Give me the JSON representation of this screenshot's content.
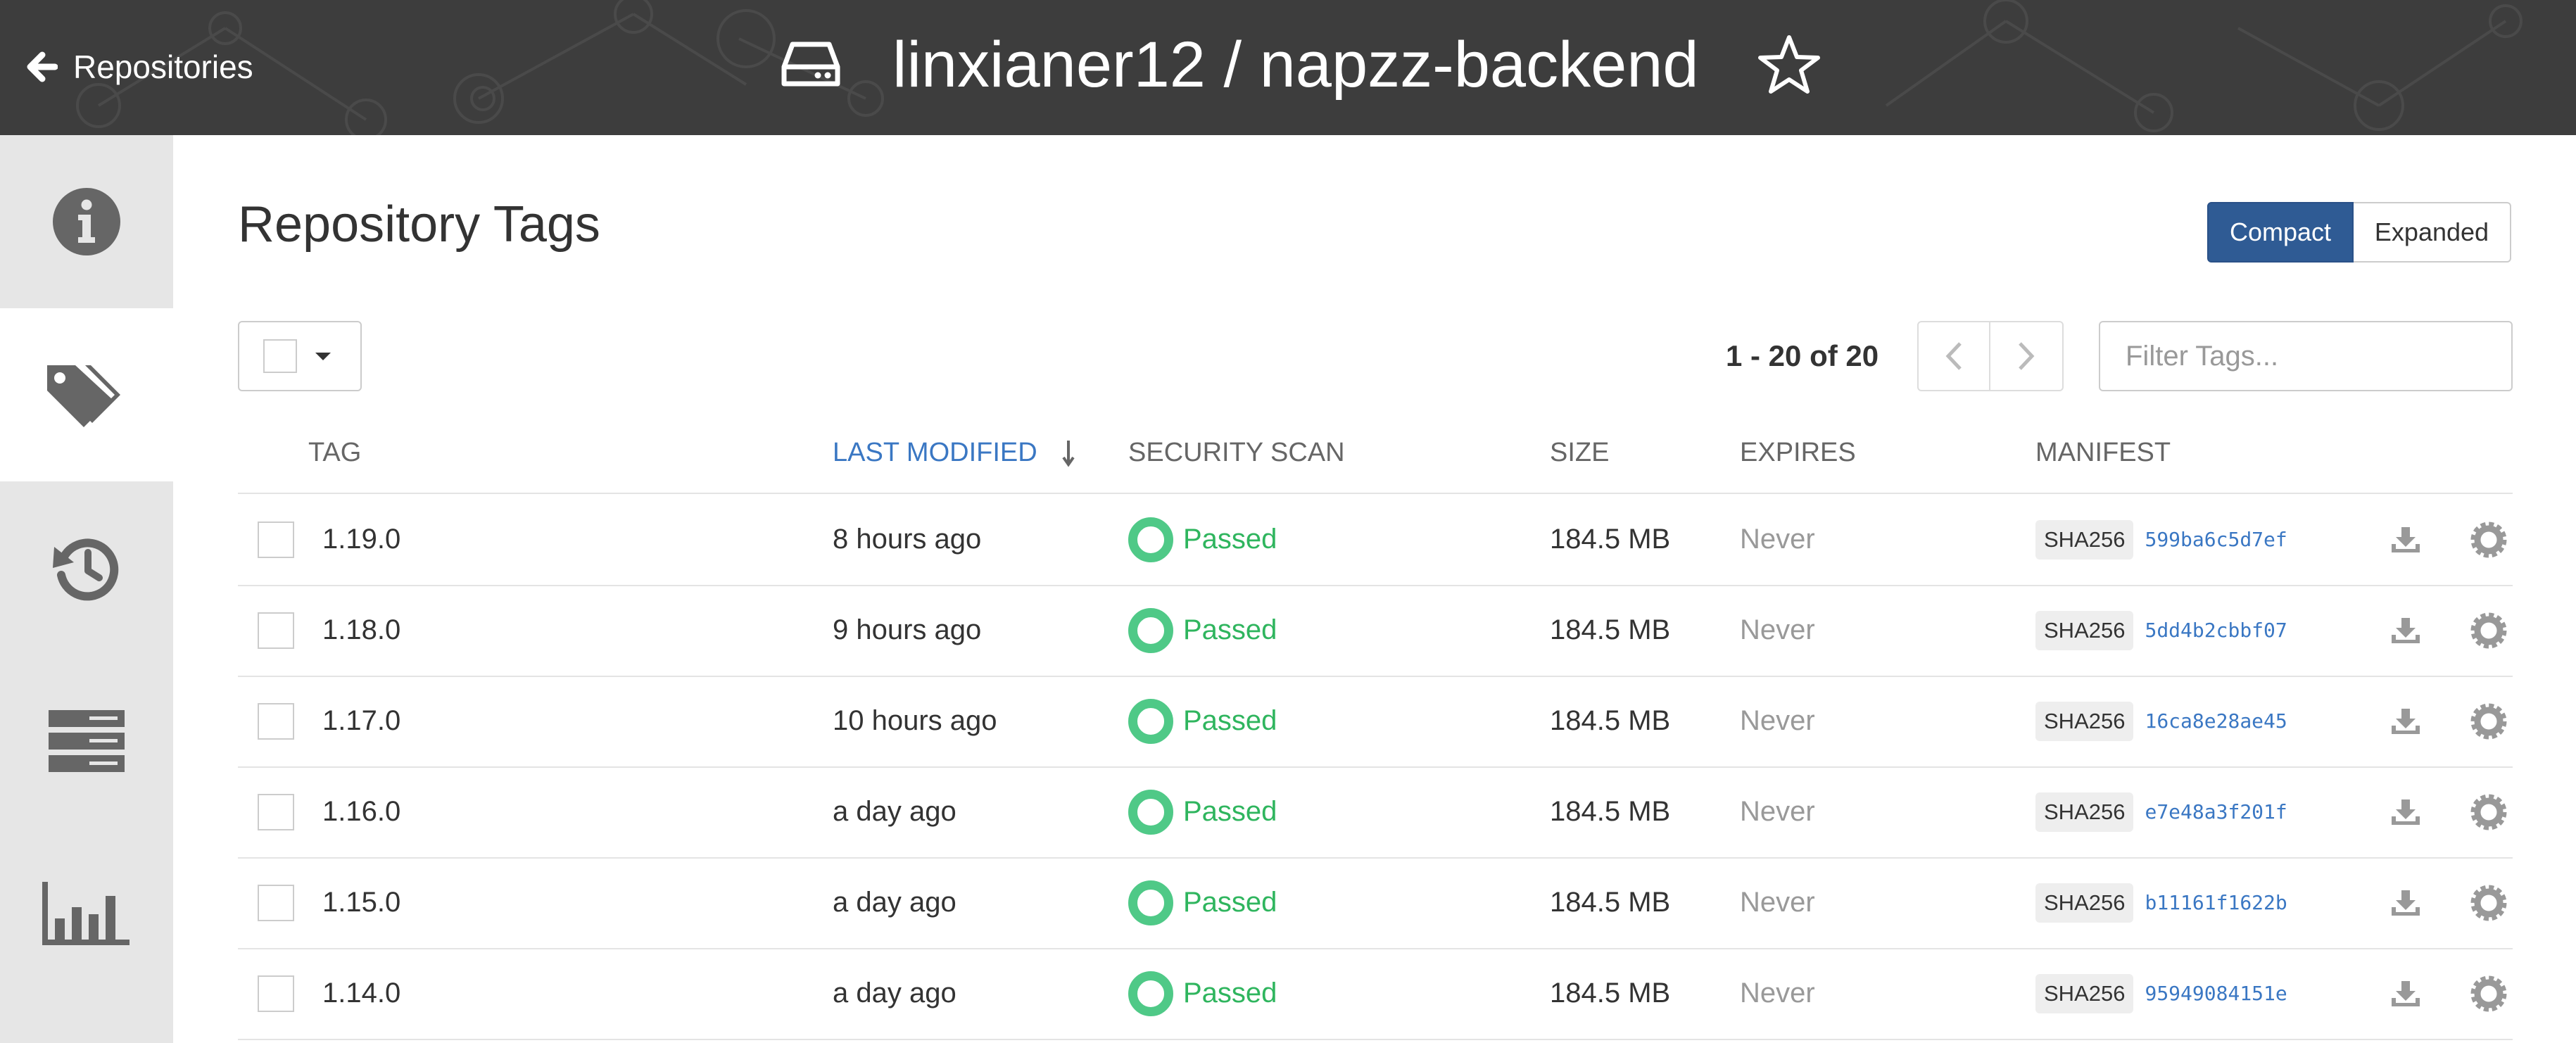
{
  "header": {
    "back_label": "Repositories",
    "repo_name": "linxianer12 / napzz-backend",
    "icons": {
      "back": "arrow-left-icon",
      "repo": "hard-drive-icon",
      "star": "star-outline-icon"
    }
  },
  "sidebar": {
    "items": [
      {
        "id": "info",
        "icon": "info-circle-icon",
        "active": false
      },
      {
        "id": "tags",
        "icon": "tags-icon",
        "active": true
      },
      {
        "id": "history",
        "icon": "history-icon",
        "active": false
      },
      {
        "id": "builds",
        "icon": "server-stack-icon",
        "active": false
      },
      {
        "id": "usage",
        "icon": "bar-chart-icon",
        "active": false
      }
    ]
  },
  "main": {
    "title": "Repository Tags",
    "view_toggle": {
      "compact": "Compact",
      "expanded": "Expanded",
      "selected": "Compact"
    },
    "pagination": {
      "range": "1 - 20 of 20"
    },
    "filter": {
      "placeholder": "Filter Tags...",
      "value": ""
    },
    "columns": {
      "tag": "TAG",
      "last_modified": "LAST MODIFIED",
      "security_scan": "SECURITY SCAN",
      "size": "SIZE",
      "expires": "EXPIRES",
      "manifest": "MANIFEST"
    },
    "sort": {
      "column": "last_modified",
      "direction": "descending",
      "icon": "arrow-down-icon"
    },
    "rows": [
      {
        "tag": "1.19.0",
        "last_modified": "8 hours ago",
        "scan": "Passed",
        "size": "184.5 MB",
        "expires": "Never",
        "algo": "SHA256",
        "digest": "599ba6c5d7ef"
      },
      {
        "tag": "1.18.0",
        "last_modified": "9 hours ago",
        "scan": "Passed",
        "size": "184.5 MB",
        "expires": "Never",
        "algo": "SHA256",
        "digest": "5dd4b2cbbf07"
      },
      {
        "tag": "1.17.0",
        "last_modified": "10 hours ago",
        "scan": "Passed",
        "size": "184.5 MB",
        "expires": "Never",
        "algo": "SHA256",
        "digest": "16ca8e28ae45"
      },
      {
        "tag": "1.16.0",
        "last_modified": "a day ago",
        "scan": "Passed",
        "size": "184.5 MB",
        "expires": "Never",
        "algo": "SHA256",
        "digest": "e7e48a3f201f"
      },
      {
        "tag": "1.15.0",
        "last_modified": "a day ago",
        "scan": "Passed",
        "size": "184.5 MB",
        "expires": "Never",
        "algo": "SHA256",
        "digest": "b11161f1622b"
      },
      {
        "tag": "1.14.0",
        "last_modified": "a day ago",
        "scan": "Passed",
        "size": "184.5 MB",
        "expires": "Never",
        "algo": "SHA256",
        "digest": "95949084151e"
      }
    ]
  },
  "colors": {
    "header_bg": "#3d3d3d",
    "sidebar_bg": "#e6e6e6",
    "primary": "#2f5b94",
    "link": "#3a77c3",
    "passed": "#2fb55e",
    "passed_ring": "#4fc987",
    "muted": "#999999"
  }
}
